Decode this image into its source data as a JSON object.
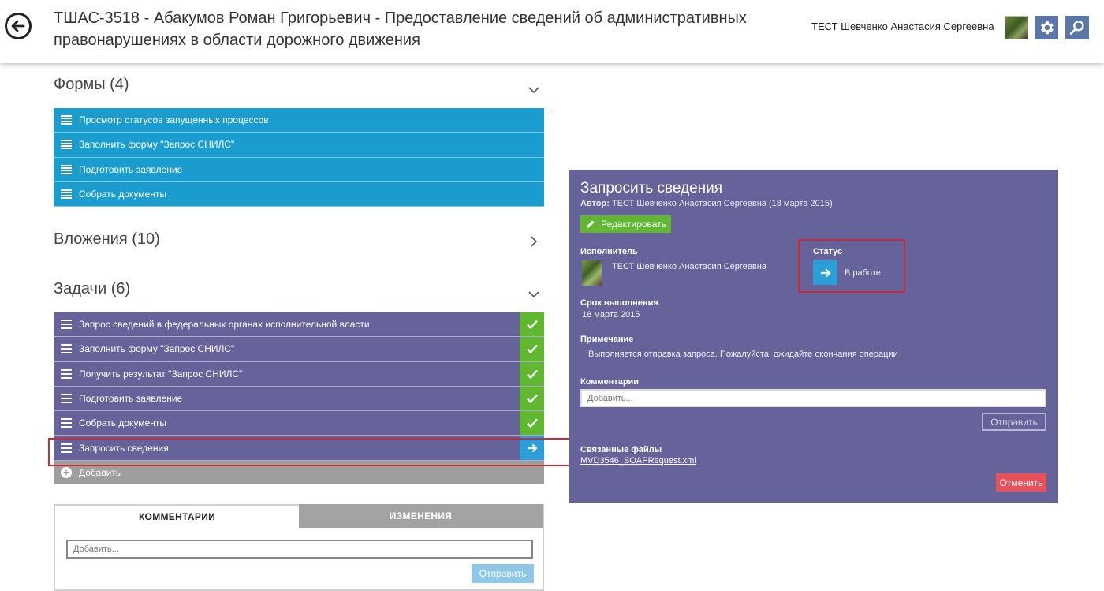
{
  "header": {
    "title": "ТШАС-3518 - Абакумов Роман Григорьевич - Предоставление сведений об административных правонарушениях в области дорожного движения",
    "user_name": "ТЕСТ Шевченко Анастасия Сергеевна"
  },
  "forms": {
    "title": "Формы (4)",
    "items": [
      {
        "label": "Просмотр статусов запущенных процессов"
      },
      {
        "label": "Заполнить форму \"Запрос СНИЛС\""
      },
      {
        "label": "Подготовить заявление"
      },
      {
        "label": "Собрать документы"
      }
    ]
  },
  "attachments": {
    "title": "Вложения (10)"
  },
  "tasks": {
    "title": "Задачи (6)",
    "items": [
      {
        "label": "Запрос сведений в федеральных органах исполнительной власти",
        "status": "done"
      },
      {
        "label": "Заполнить форму \"Запрос СНИЛС\"",
        "status": "done"
      },
      {
        "label": "Получить результат \"Запрос СНИЛС\"",
        "status": "done"
      },
      {
        "label": "Подготовить заявление",
        "status": "done"
      },
      {
        "label": "Собрать документы",
        "status": "done"
      },
      {
        "label": "Запросить сведения",
        "status": "in-progress"
      }
    ],
    "add_label": "Добавить"
  },
  "comments_panel": {
    "tab_comments": "КОММЕНТАРИИ",
    "tab_changes": "ИЗМЕНЕНИЯ",
    "input_placeholder": "Добавить...",
    "send_label": "Отправить"
  },
  "task_detail": {
    "title": "Запросить сведения",
    "author_label": "Автор:",
    "author_value": "ТЕСТ Шевченко Анастасия Сергеевна (18 марта 2015)",
    "edit_label": "Редактировать",
    "executor_label": "Исполнитель",
    "executor_name": "ТЕСТ Шевченко Анастасия Сергеевна",
    "status_label": "Статус",
    "status_value": "В работе",
    "deadline_label": "Срок выполнения",
    "deadline_value": "18 марта 2015",
    "note_label": "Примечание",
    "note_value": "Выполняется отправка запроса. Пожалуйста, ожидайте окончания операции",
    "comments_label": "Комментарии",
    "comment_placeholder": "Добавить...",
    "send_label": "Отправить",
    "files_label": "Связанные файлы",
    "file_name": "MVD3546_SOAPRequest.xml",
    "cancel_label": "Отменить"
  },
  "colors": {
    "forms_row": "#1a9ccf",
    "tasks_row": "#66639a",
    "done": "#5fb830",
    "in_progress": "#2d9fd8",
    "highlight": "#cc2a34",
    "cancel": "#e8515a"
  }
}
